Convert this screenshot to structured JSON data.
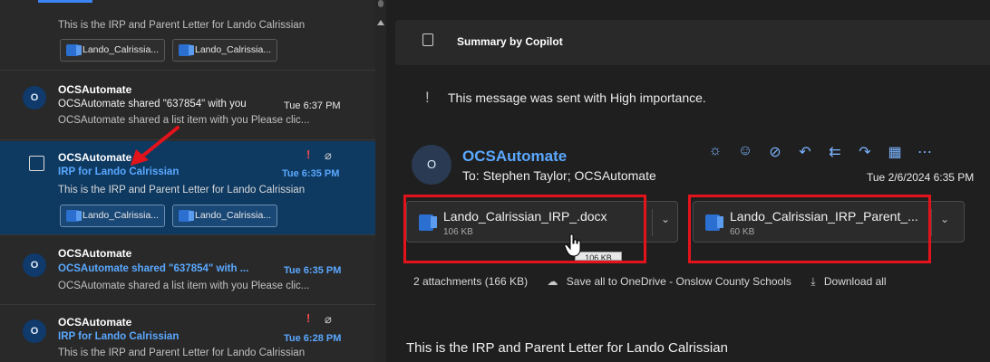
{
  "messages": [
    {
      "preview": "This is the IRP and Parent Letter for Lando Calrissian",
      "attachments": [
        "Lando_Calrissia...",
        "Lando_Calrissia..."
      ]
    },
    {
      "avatar": "O",
      "sender": "OCSAutomate",
      "subject": "OCSAutomate shared \"637854\" with you",
      "time": "Tue 6:37 PM",
      "preview": "OCSAutomate shared a list item with you Please clic..."
    },
    {
      "sender": "OCSAutomate",
      "subject": "IRP for Lando Calrissian",
      "time": "Tue 6:35 PM",
      "preview": "This is the IRP and Parent Letter for Lando Calrissian",
      "attachments": [
        "Lando_Calrissia...",
        "Lando_Calrissia..."
      ],
      "important": "!",
      "clip": "⌀"
    },
    {
      "avatar": "O",
      "sender": "OCSAutomate",
      "subject": "OCSAutomate shared \"637854\" with ...",
      "time": "Tue 6:35 PM",
      "preview": "OCSAutomate shared a list item with you Please clic..."
    },
    {
      "avatar": "O",
      "sender": "OCSAutomate",
      "subject": "IRP for Lando Calrissian",
      "time": "Tue 6:28 PM",
      "preview": "This is the IRP and Parent Letter for Lando Calrissian",
      "important": "!",
      "clip": "⌀"
    }
  ],
  "reading": {
    "copilot_label": "Summary by Copilot",
    "close": "✕",
    "importance_mark": "!",
    "importance_text": "This message was sent with High importance.",
    "avatar": "O",
    "from": "OCSAutomate",
    "to": "To:  Stephen Taylor;  OCSAutomate",
    "date": "Tue 2/6/2024 6:35 PM",
    "actions": [
      "☼",
      "☺",
      "⊘",
      "↶",
      "⇇",
      "↷",
      "▦",
      "⋯"
    ],
    "attachments": [
      {
        "name": "Lando_Calrissian_IRP_.docx",
        "size": "106 KB"
      },
      {
        "name": "Lando_Calrissian_IRP_Parent_...",
        "size": "60 KB"
      }
    ],
    "tooltip": "106 KB",
    "attachment_summary": "2 attachments (166 KB)",
    "save_all": "Save all to OneDrive - Onslow County Schools",
    "download_all": "Download all",
    "body": "This is the IRP and Parent Letter for Lando Calrissian"
  },
  "colors": {
    "accent": "#5aa8ff",
    "selected": "#0e3a62",
    "highlight": "#e3131b",
    "important": "#ef4b4b"
  }
}
